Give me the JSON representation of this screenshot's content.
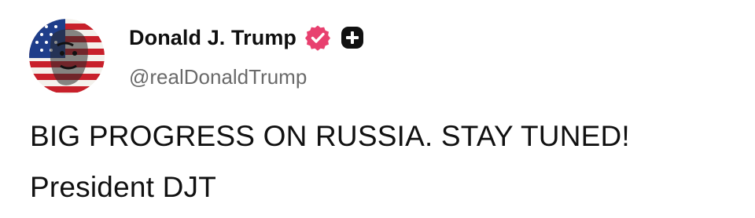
{
  "post": {
    "author": {
      "display_name": "Donald J. Trump",
      "handle": "@realDonaldTrump",
      "avatar_icon": "flag-portrait-avatar",
      "verified_icon": "verified-badge-icon",
      "verified_color": "#e8406f",
      "plus_icon": "plus-square-icon"
    },
    "body": {
      "line_1": "BIG PROGRESS ON RUSSIA. STAY TUNED!",
      "line_2": "President DJT"
    }
  }
}
